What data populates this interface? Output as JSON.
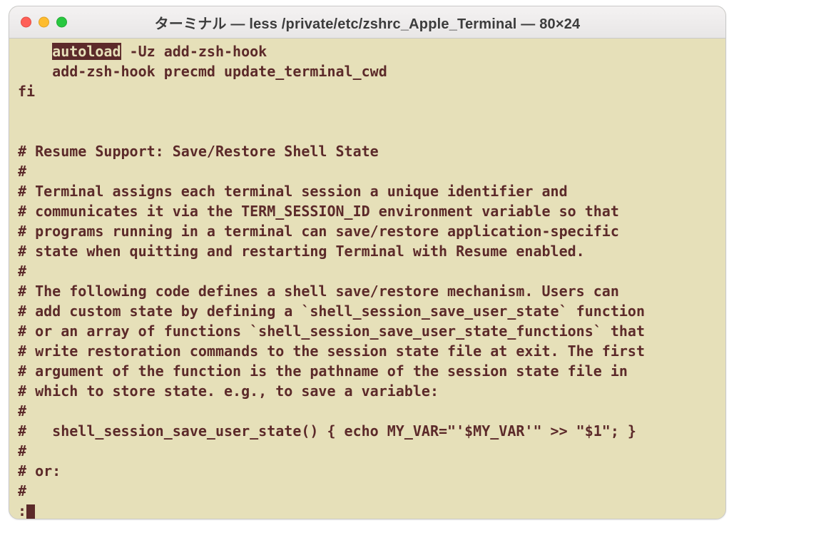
{
  "window": {
    "title": "ターミナル — less /private/etc/zshrc_Apple_Terminal — 80×24"
  },
  "traffic": {
    "close": "close",
    "minimize": "minimize",
    "zoom": "zoom"
  },
  "lines": {
    "l01_indent": "    ",
    "l01_hl": "autoload",
    "l01_rest": " -Uz add-zsh-hook",
    "l02": "    add-zsh-hook precmd update_terminal_cwd",
    "l03": "fi",
    "l04": "",
    "l05": "",
    "l06": "# Resume Support: Save/Restore Shell State",
    "l07": "#",
    "l08": "# Terminal assigns each terminal session a unique identifier and",
    "l09": "# communicates it via the TERM_SESSION_ID environment variable so that",
    "l10": "# programs running in a terminal can save/restore application-specific",
    "l11": "# state when quitting and restarting Terminal with Resume enabled.",
    "l12": "#",
    "l13": "# The following code defines a shell save/restore mechanism. Users can",
    "l14": "# add custom state by defining a `shell_session_save_user_state` function",
    "l15": "# or an array of functions `shell_session_save_user_state_functions` that",
    "l16": "# write restoration commands to the session state file at exit. The first",
    "l17": "# argument of the function is the pathname of the session state file in",
    "l18": "# which to store state. e.g., to save a variable:",
    "l19": "#",
    "l20": "#   shell_session_save_user_state() { echo MY_VAR=\"'$MY_VAR'\" >> \"$1\"; }",
    "l21": "#",
    "l22": "# or:",
    "l23": "#",
    "prompt": ":"
  }
}
